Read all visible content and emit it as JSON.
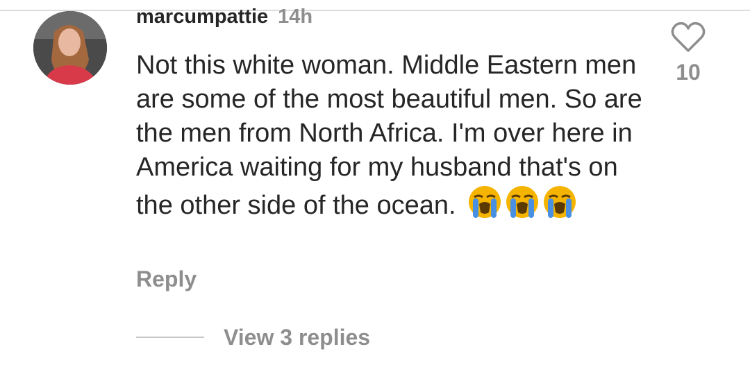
{
  "comment": {
    "username": "marcumpattie",
    "time": "14h",
    "text": "Not this white woman. Middle Eastern men are some of the most beautiful men. So are the men from North Africa. I'm over here in America waiting for my husband that's on the other side of the ocean.",
    "emojis": [
      "loudly-crying-face",
      "loudly-crying-face",
      "loudly-crying-face"
    ],
    "like_count": "10",
    "reply_label": "Reply",
    "view_replies_label": "View 3 replies"
  },
  "icons": {
    "like": "heart-outline-icon",
    "avatar": "user-avatar"
  },
  "colors": {
    "primary_text": "#262626",
    "secondary_text": "#8e8e8e",
    "divider": "#dbdbdb",
    "emoji_face": "#f4b400",
    "emoji_tears": "#4a90e2"
  }
}
